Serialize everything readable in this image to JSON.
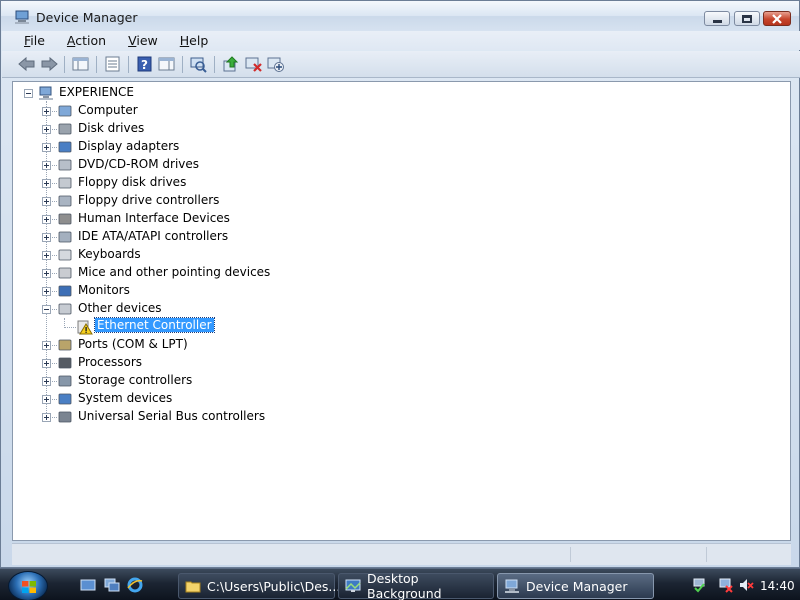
{
  "window": {
    "title": "Device Manager",
    "menu": [
      {
        "label_ul": "F",
        "label_rest": "ile"
      },
      {
        "label_ul": "A",
        "label_rest": "ction"
      },
      {
        "label_ul": "V",
        "label_rest": "iew"
      },
      {
        "label_ul": "H",
        "label_rest": "elp"
      }
    ]
  },
  "toolbar": {
    "buttons": [
      "back-icon",
      "forward-icon",
      "show-hide-console-tree-icon",
      "properties-icon",
      "help-icon",
      "action-pane-icon",
      "scan-hardware-icon",
      "update-driver-icon",
      "uninstall-icon",
      "disable-icon"
    ]
  },
  "tree": {
    "root": "EXPERIENCE",
    "categories": [
      "Computer",
      "Disk drives",
      "Display adapters",
      "DVD/CD-ROM drives",
      "Floppy disk drives",
      "Floppy drive controllers",
      "Human Interface Devices",
      "IDE ATA/ATAPI controllers",
      "Keyboards",
      "Mice and other pointing devices",
      "Monitors",
      "Other devices",
      "Ports (COM & LPT)",
      "Processors",
      "Storage controllers",
      "System devices",
      "Universal Serial Bus controllers"
    ],
    "selected_child": "Ethernet Controller"
  },
  "taskbar": {
    "tasks": [
      "C:\\Users\\Public\\Des...",
      "Desktop Background",
      "Device Manager"
    ],
    "clock": "14:40"
  },
  "colors": {
    "selection": "#3399ff",
    "taskbar": "#1c2533",
    "close_button": "#c7452c"
  }
}
